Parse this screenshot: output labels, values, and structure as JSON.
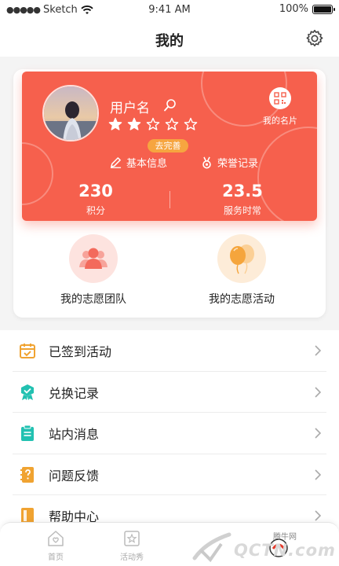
{
  "status_bar": {
    "carrier": "Sketch",
    "time": "9:41 AM",
    "battery": "100%"
  },
  "nav": {
    "title": "我的",
    "settings_icon": "gear-icon"
  },
  "profile": {
    "username": "用户名",
    "rating": 2,
    "rating_max": 5,
    "complete_badge": "去完善",
    "qr_label": "我的名片",
    "basic_info": "基本信息",
    "honor_record": "荣誉记录",
    "stats": [
      {
        "value": "230",
        "label": "积分"
      },
      {
        "value": "23.5",
        "label": "服务时常"
      }
    ]
  },
  "features": [
    {
      "label": "我的志愿团队",
      "icon": "team-icon"
    },
    {
      "label": "我的志愿活动",
      "icon": "balloon-icon"
    }
  ],
  "menu": [
    {
      "label": "已签到活动",
      "icon": "calendar-check-icon"
    },
    {
      "label": "兑换记录",
      "icon": "badge-icon"
    },
    {
      "label": "站内消息",
      "icon": "clipboard-icon"
    },
    {
      "label": "问题反馈",
      "icon": "question-notebook-icon"
    },
    {
      "label": "帮助中心",
      "icon": "book-icon"
    }
  ],
  "tabs": [
    {
      "label": "首页",
      "icon": "home-icon"
    },
    {
      "label": "活动秀",
      "icon": "star-square-icon"
    }
  ],
  "watermark": {
    "brand": "QCTN.com",
    "small": "腾牛网"
  },
  "colors": {
    "accent": "#f6604d",
    "badge": "#f6a540",
    "icon_orange": "#f0a331",
    "icon_teal": "#22c1b1"
  }
}
